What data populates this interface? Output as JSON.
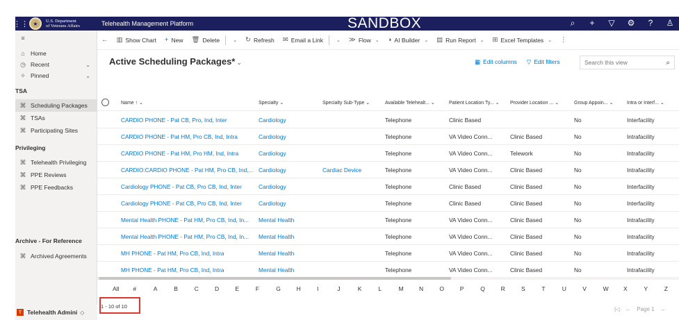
{
  "header": {
    "agency_line1": "U.S. Department",
    "agency_line2": "of Veterans Affairs",
    "app_title": "Telehealth Management Platform",
    "environment": "SANDBOX"
  },
  "sidebar": {
    "items": [
      {
        "label": "Home",
        "icon": "home-icon"
      },
      {
        "label": "Recent",
        "icon": "clock-icon"
      },
      {
        "label": "Pinned",
        "icon": "pin-icon"
      }
    ],
    "group_tsa": "TSA",
    "tsa_items": [
      "Scheduling Packages",
      "TSAs",
      "Participating Sites"
    ],
    "group_privileging": "Privileging",
    "privileging_items": [
      "Telehealth Privileging",
      "PPE Reviews",
      "PPE Feedbacks"
    ],
    "group_archive": "Archive - For Reference",
    "archive_items": [
      "Archived Agreements"
    ],
    "area_badge": "T",
    "area_label": "Telehealth Admini"
  },
  "toolbar": {
    "show_chart": "Show Chart",
    "new": "New",
    "delete": "Delete",
    "refresh": "Refresh",
    "email_link": "Email a Link",
    "flow": "Flow",
    "ai_builder": "AI Builder",
    "run_report": "Run Report",
    "excel_templates": "Excel Templates"
  },
  "view": {
    "title": "Active Scheduling Packages*",
    "edit_columns": "Edit columns",
    "edit_filters": "Edit filters",
    "search_placeholder": "Search this view"
  },
  "columns": [
    "Name ↑ ⌄",
    "Specialty ⌄",
    "Specialty Sub-Type ⌄",
    "Available Telehealt... ⌄",
    "Patient Location Ty... ⌄",
    "Provider Location ... ⌄",
    "Group Appoin... ⌄",
    "Intra or Interf... ⌄"
  ],
  "rows": [
    {
      "name": "CARDIO PHONE - Pat CB, Pro, Ind, Inter",
      "specialty": "Cardiology",
      "subtype": "",
      "modality": "Telephone",
      "patient_loc": "Clinic Based",
      "provider_loc": "",
      "group": "No",
      "intra": "Interfacility"
    },
    {
      "name": "CARDIO PHONE - Pat HM, Pro CB, Ind, Intra",
      "specialty": "Cardiology",
      "subtype": "",
      "modality": "Telephone",
      "patient_loc": "VA Video Conn...",
      "provider_loc": "Clinic Based",
      "group": "No",
      "intra": "Intrafacility"
    },
    {
      "name": "CARDIO PHONE - Pat HM, Pro HM, Ind, Intra",
      "specialty": "Cardiology",
      "subtype": "",
      "modality": "Telephone",
      "patient_loc": "VA Video Conn...",
      "provider_loc": "Telework",
      "group": "No",
      "intra": "Intrafacility"
    },
    {
      "name": "CARDIO:CARDIO PHONE - Pat HM, Pro CB, Ind,...",
      "specialty": "Cardiology",
      "subtype": "Cardiac Device",
      "modality": "Telephone",
      "patient_loc": "VA Video Conn...",
      "provider_loc": "Clinic Based",
      "group": "No",
      "intra": "Intrafacility"
    },
    {
      "name": "Cardiology PHONE - Pat CB, Pro CB, Ind, Inter",
      "specialty": "Cardiology",
      "subtype": "",
      "modality": "Telephone",
      "patient_loc": "Clinic Based",
      "provider_loc": "Clinic Based",
      "group": "No",
      "intra": "Interfacility"
    },
    {
      "name": "Cardiology PHONE - Pat CB, Pro CB, Ind, Inter",
      "specialty": "Cardiology",
      "subtype": "",
      "modality": "Telephone",
      "patient_loc": "Clinic Based",
      "provider_loc": "Clinic Based",
      "group": "No",
      "intra": "Interfacility"
    },
    {
      "name": "Mental Health PHONE - Pat HM, Pro CB, Ind, In...",
      "specialty": "Mental Health",
      "subtype": "",
      "modality": "Telephone",
      "patient_loc": "VA Video Conn...",
      "provider_loc": "Clinic Based",
      "group": "No",
      "intra": "Intrafacility"
    },
    {
      "name": "Mental Health PHONE - Pat HM, Pro CB, Ind, In...",
      "specialty": "Mental Health",
      "subtype": "",
      "modality": "Telephone",
      "patient_loc": "VA Video Conn...",
      "provider_loc": "Clinic Based",
      "group": "No",
      "intra": "Intrafacility"
    },
    {
      "name": "MH PHONE - Pat HM, Pro CB, Ind, Intra",
      "specialty": "Mental Health",
      "subtype": "",
      "modality": "Telephone",
      "patient_loc": "VA Video Conn...",
      "provider_loc": "Clinic Based",
      "group": "No",
      "intra": "Intrafacility"
    },
    {
      "name": "MH PHONE - Pat HM, Pro CB, Ind, Intra",
      "specialty": "Mental Health",
      "subtype": "",
      "modality": "Telephone",
      "patient_loc": "VA Video Conn...",
      "provider_loc": "Clinic Based",
      "group": "No",
      "intra": "Intrafacility"
    }
  ],
  "alphabet": [
    "All",
    "#",
    "A",
    "B",
    "C",
    "D",
    "E",
    "F",
    "G",
    "H",
    "I",
    "J",
    "K",
    "L",
    "M",
    "N",
    "O",
    "P",
    "Q",
    "R",
    "S",
    "T",
    "U",
    "V",
    "W",
    "X",
    "Y",
    "Z"
  ],
  "footer": {
    "record_count": "1 - 10 of 10",
    "page_label": "Page 1"
  },
  "colors": {
    "header_bg": "#1b1f5e",
    "link": "#0078d4",
    "highlight_box": "#e0352b"
  }
}
